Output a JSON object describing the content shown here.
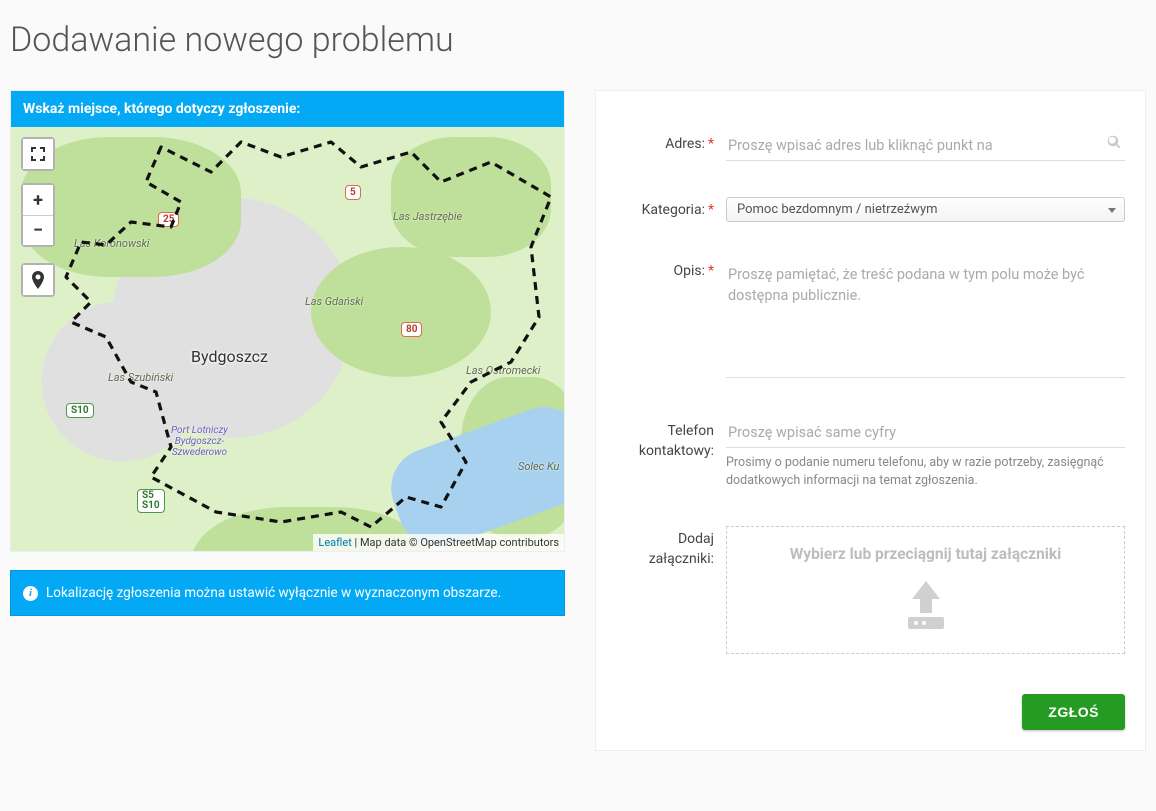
{
  "page": {
    "title": "Dodawanie nowego problemu"
  },
  "map_panel": {
    "header": "Wskaż miejsce, którego dotyczy zgłoszenie:",
    "attribution_link": "Leaflet",
    "attribution_text": " | Map data © OpenStreetMap contributors",
    "labels": {
      "city": "Bydgoszcz",
      "las_jastrzebie": "Las Jastrzębie",
      "las_koronowski": "Las Koronowski",
      "las_gdanski": "Las Gdański",
      "las_ostromecki": "Las Ostromecki",
      "las_szubinski": "Las Szubiński",
      "solec": "Solec Ku",
      "airport": "Port Lotniczy\nBydgoszcz-\nSzwederowo"
    },
    "shields": {
      "s25": "25",
      "s5": "5",
      "s80": "80",
      "s10": "S10",
      "s5s10": "S5\nS10"
    }
  },
  "info_alert": {
    "text": "Lokalizację zgłoszenia można ustawić wyłącznie w wyznaczonym obszarze."
  },
  "form": {
    "address": {
      "label": "Adres:",
      "placeholder": "Proszę wpisać adres lub kliknąć punkt na"
    },
    "category": {
      "label": "Kategoria:",
      "selected": "Pomoc bezdomnym / nietrzeźwym"
    },
    "description": {
      "label": "Opis:",
      "placeholder": "Proszę pamiętać, że treść podana w tym polu może być dostępna publicznie."
    },
    "phone": {
      "label": "Telefon kontaktowy:",
      "placeholder": "Proszę wpisać same cyfry",
      "help": "Prosimy o podanie numeru telefonu, aby w razie potrzeby, zasięgnąć dodatkowych informacji na temat zgłoszenia."
    },
    "attachments": {
      "label": "Dodaj załączniki:",
      "dropzone_text": "Wybierz lub przeciągnij tutaj załączniki"
    },
    "submit": "ZGŁOŚ"
  }
}
